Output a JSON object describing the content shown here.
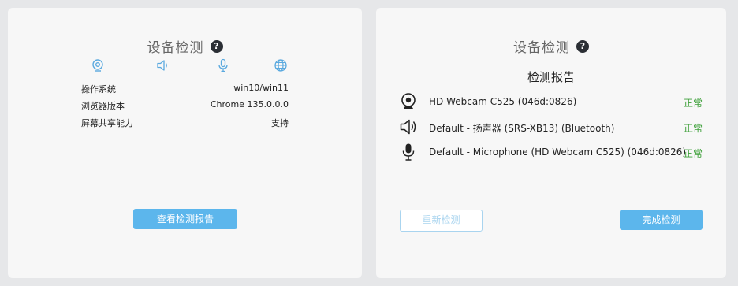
{
  "left_panel": {
    "title": "设备检测",
    "help_icon": "?",
    "steps": [
      "camera-icon",
      "speaker-icon",
      "microphone-icon",
      "network-globe-icon"
    ],
    "info": [
      {
        "label": "操作系统",
        "value": "win10/win11"
      },
      {
        "label": "浏览器版本",
        "value": "Chrome 135.0.0.0"
      },
      {
        "label": "屏幕共享能力",
        "value": "支持"
      }
    ],
    "view_report_button": "查看检测报告"
  },
  "right_panel": {
    "title": "设备检测",
    "help_icon": "?",
    "report_title": "检测报告",
    "devices": [
      {
        "icon": "camera-icon",
        "name": "HD Webcam C525 (046d:0826)",
        "status": "正常"
      },
      {
        "icon": "speaker-icon",
        "name": "Default - 扬声器 (SRS-XB13) (Bluetooth)",
        "status": "正常"
      },
      {
        "icon": "microphone-icon",
        "name": "Default - Microphone (HD Webcam C525) (046d:0826)",
        "status": "正常"
      }
    ],
    "retest_button": "重新检测",
    "finish_button": "完成检测"
  },
  "colors": {
    "accent": "#5cb6ec",
    "ok_status": "#3ea03a",
    "help_bg": "#2b2f35"
  }
}
